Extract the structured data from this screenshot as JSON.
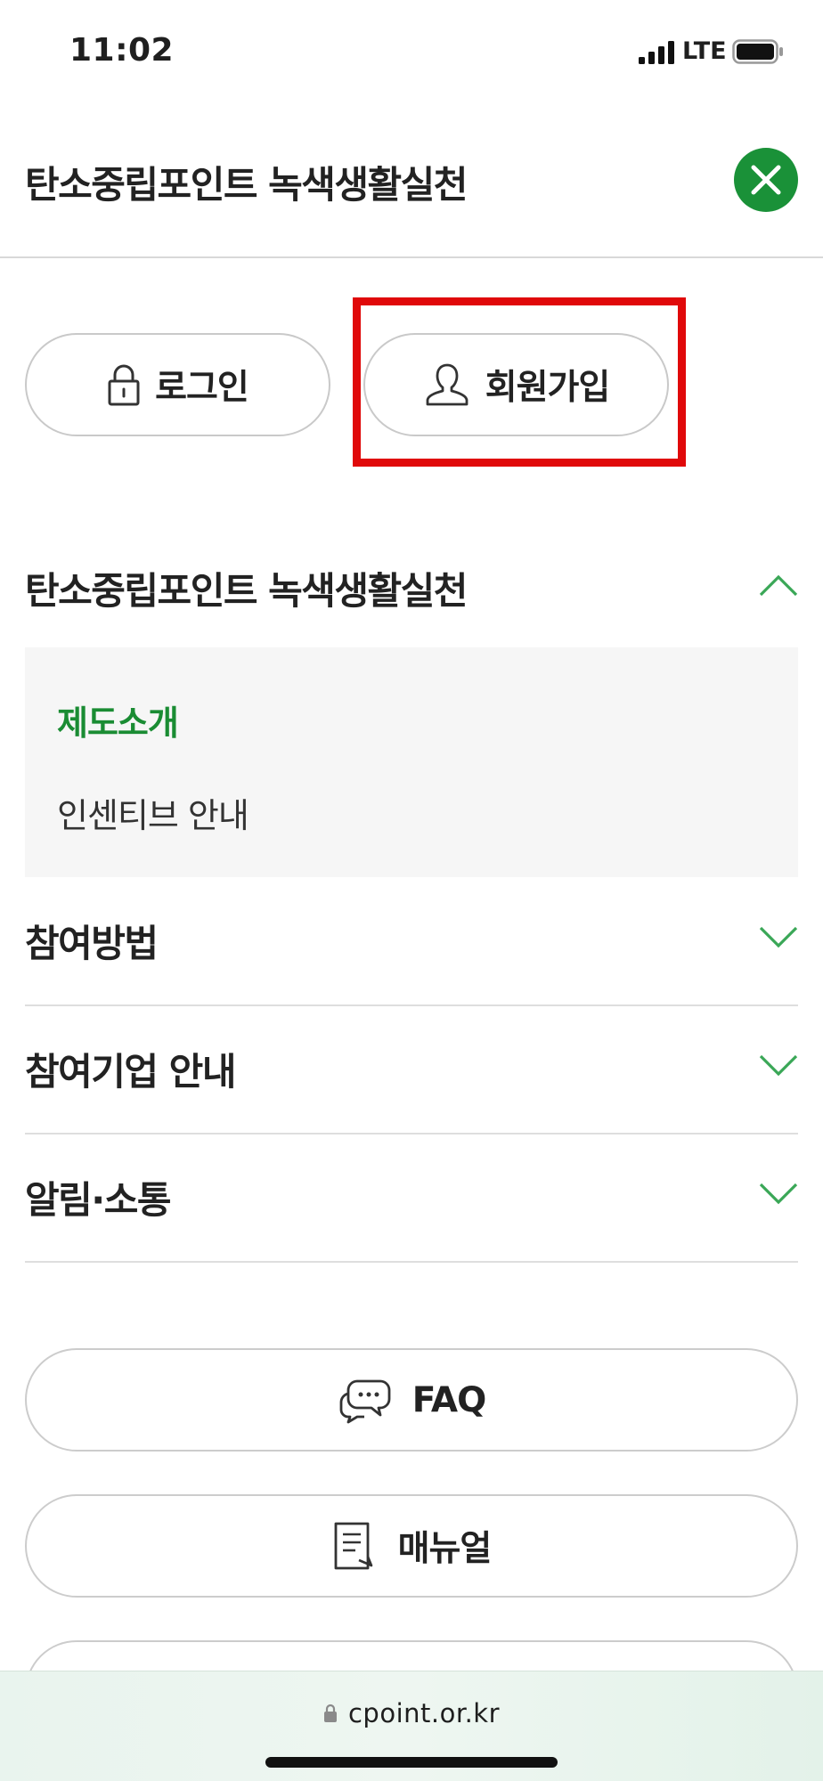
{
  "status_bar": {
    "time": "11:02",
    "network": "LTE",
    "icons": [
      "signal-icon",
      "battery-icon"
    ]
  },
  "header": {
    "title": "탄소중립포인트 녹색생활실천",
    "close_icon": "close-icon",
    "accent_color": "#1a9138"
  },
  "account": {
    "login_label": "로그인",
    "login_icon": "lock-icon",
    "signup_label": "회원가입",
    "signup_icon": "person-icon",
    "highlight_color": "#e0090a"
  },
  "menu": {
    "sections": [
      {
        "label": "탄소중립포인트 녹색생활실천",
        "expanded": true
      },
      {
        "label": "참여방법",
        "expanded": false
      },
      {
        "label": "참여기업 안내",
        "expanded": false
      },
      {
        "label": "알림·소통",
        "expanded": false
      }
    ],
    "submenu": [
      {
        "label": "제도소개",
        "active": true
      },
      {
        "label": "인센티브 안내",
        "active": false
      }
    ],
    "chevron_color": "#3aa757",
    "active_color": "#1a8c33"
  },
  "links": [
    {
      "label": "FAQ",
      "icon": "chat-bubbles-icon"
    },
    {
      "label": "매뉴얼",
      "icon": "document-icon"
    }
  ],
  "browser": {
    "url": "cpoint.or.kr",
    "icon": "lock-icon"
  }
}
